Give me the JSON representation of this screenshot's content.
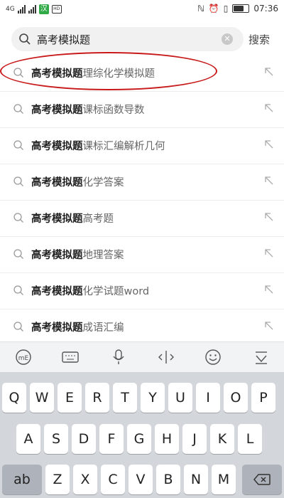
{
  "status_bar": {
    "network": "4G",
    "hd": "HD",
    "time": "07:36"
  },
  "search": {
    "query": "高考模拟题",
    "search_label": "搜索"
  },
  "suggestions": [
    {
      "bold": "高考模拟题",
      "rest": "理综化学模拟题"
    },
    {
      "bold": "高考模拟题",
      "rest": "课标函数导数"
    },
    {
      "bold": "高考模拟题",
      "rest": "课标汇编解析几何"
    },
    {
      "bold": "高考模拟题",
      "rest": "化学答案"
    },
    {
      "bold": "高考模拟题",
      "rest": "高考题"
    },
    {
      "bold": "高考模拟题",
      "rest": "地理答案"
    },
    {
      "bold": "高考模拟题",
      "rest": "化学试题word"
    },
    {
      "bold": "高考模拟题",
      "rest": "成语汇编"
    }
  ],
  "toolbar": {
    "icons": [
      "input-method-icon",
      "keyboard-icon",
      "microphone-icon",
      "cursor-icon",
      "emoji-icon",
      "hide-keyboard-icon"
    ]
  },
  "keyboard": {
    "row1": [
      "Q",
      "W",
      "E",
      "R",
      "T",
      "Y",
      "U",
      "I",
      "O",
      "P"
    ],
    "row2": [
      "A",
      "S",
      "D",
      "F",
      "G",
      "H",
      "J",
      "K",
      "L"
    ],
    "row3": [
      "Z",
      "X",
      "C",
      "V",
      "B",
      "N",
      "M"
    ],
    "ab_label": "ab"
  },
  "colors": {
    "highlight": "#c81a1a",
    "keyboard_bg": "#d3d6db"
  }
}
